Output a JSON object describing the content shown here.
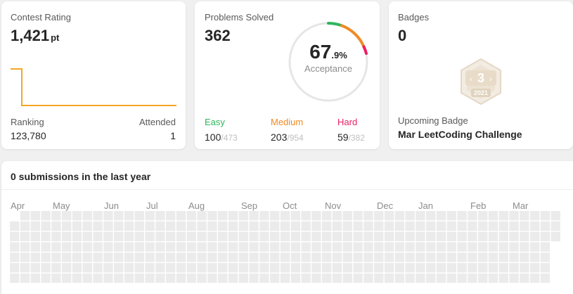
{
  "contest": {
    "label": "Contest Rating",
    "rating": "1,421",
    "unit": "pt",
    "ranking_label": "Ranking",
    "ranking": "123,780",
    "attended_label": "Attended",
    "attended": "1",
    "line_color": "#f5a623"
  },
  "problems": {
    "label": "Problems Solved",
    "solved": "362",
    "acceptance_int": "67",
    "acceptance_dec": ".9%",
    "acceptance_label": "Acceptance",
    "easy": {
      "label": "Easy",
      "solved": "100",
      "total": "/473",
      "color": "#2db55d"
    },
    "medium": {
      "label": "Medium",
      "solved": "203",
      "total": "/954",
      "color": "#f08a24"
    },
    "hard": {
      "label": "Hard",
      "solved": "59",
      "total": "/382",
      "color": "#e91e63"
    }
  },
  "badges": {
    "label": "Badges",
    "count": "0",
    "badge_number": "3",
    "badge_year": "2021",
    "upcoming_label": "Upcoming Badge",
    "upcoming_name": "Mar LeetCoding Challenge"
  },
  "submissions": {
    "title": "0 submissions in the last year",
    "months": [
      "Apr",
      "May",
      "Jun",
      "Jul",
      "Aug",
      "Sep",
      "Oct",
      "Nov",
      "Dec",
      "Jan",
      "Feb",
      "Mar"
    ],
    "cell_color": "#ebebeb"
  }
}
